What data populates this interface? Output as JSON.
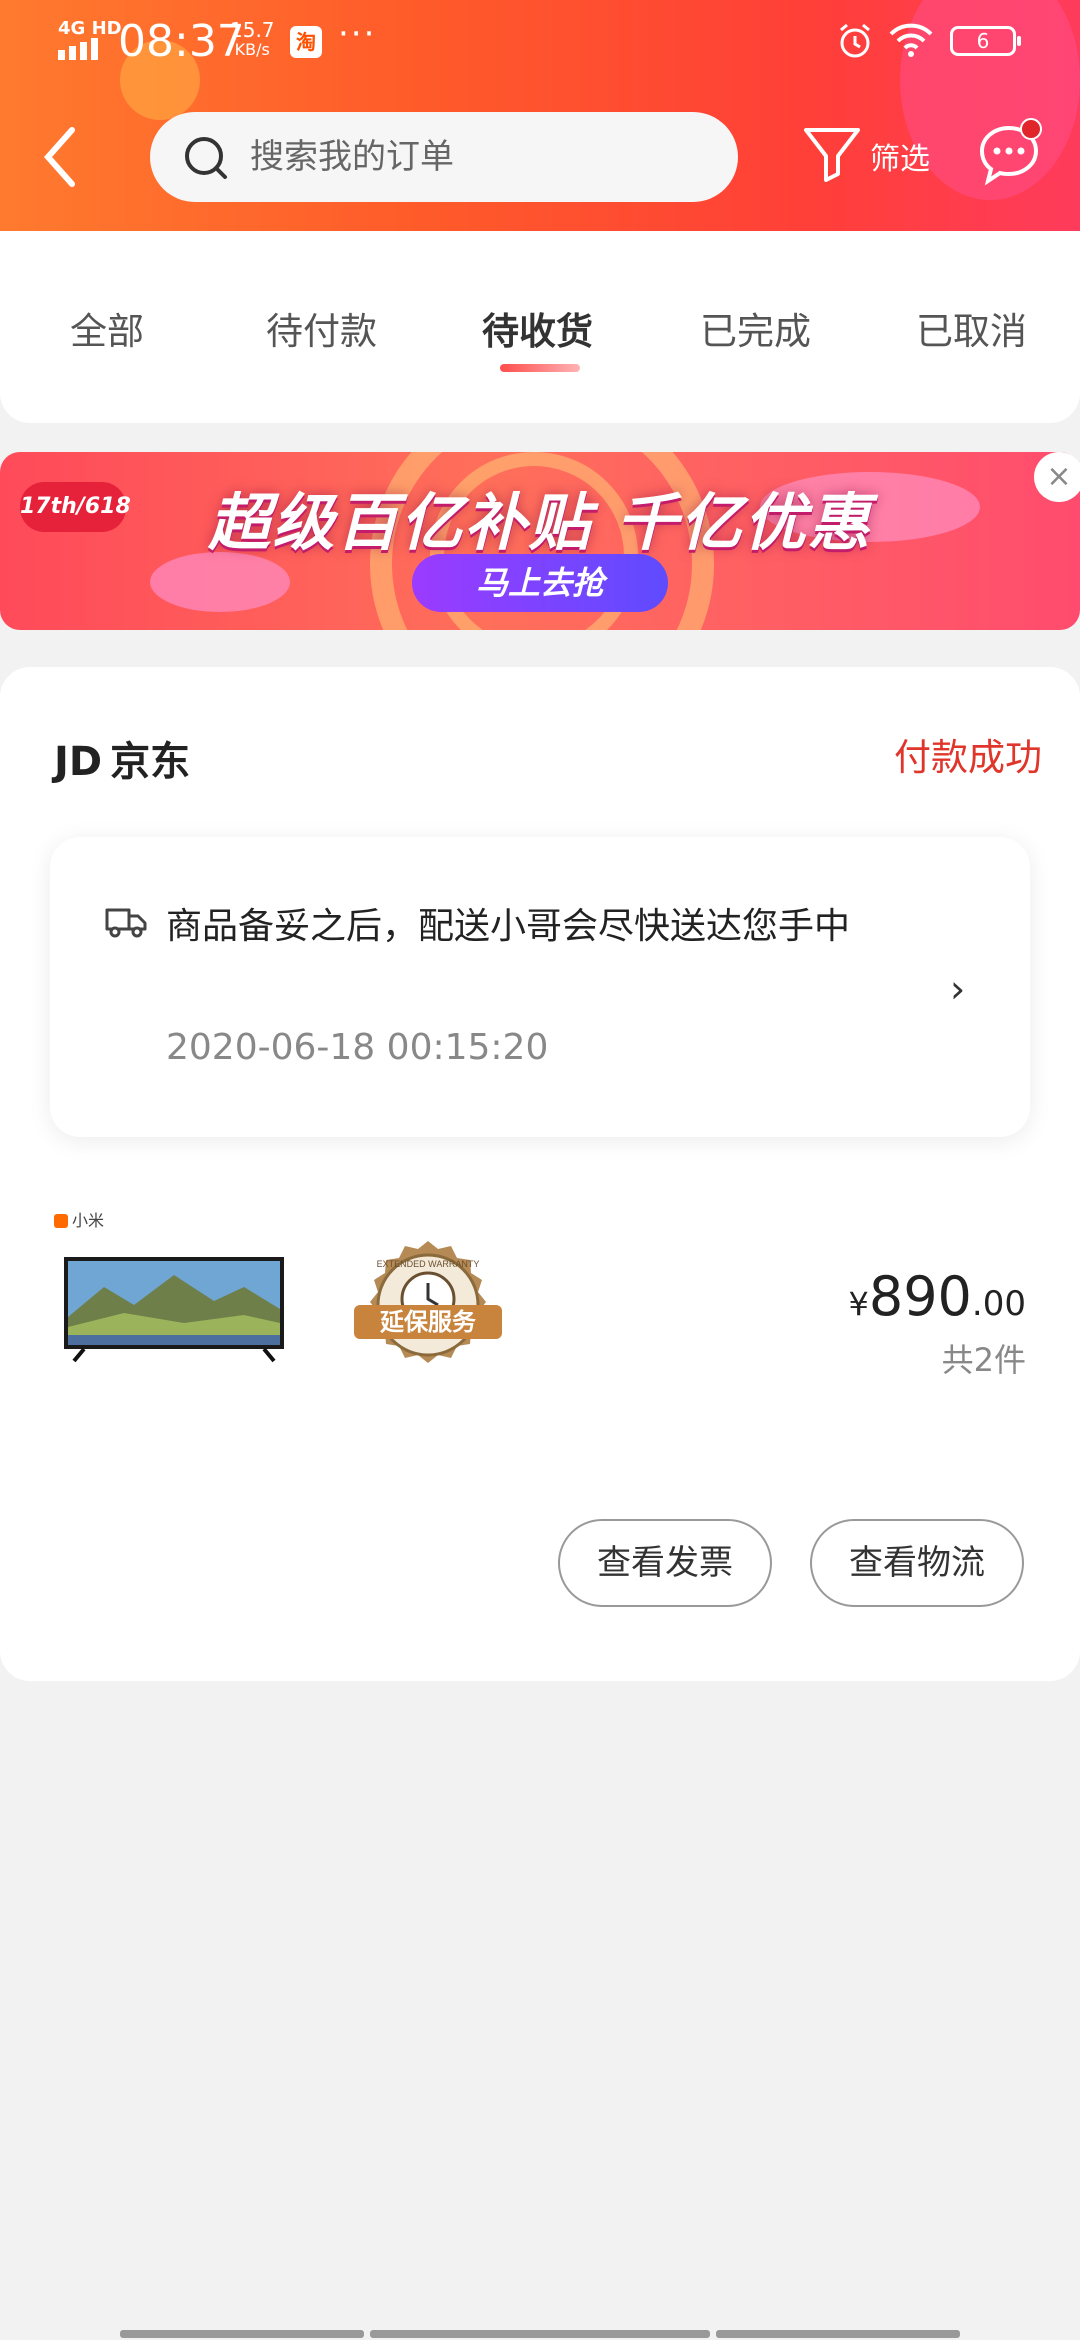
{
  "status_bar": {
    "network": "4G HD",
    "time": "08:37",
    "speed_value": "15.7",
    "speed_unit": "KB/s",
    "app_badge": "淘",
    "more": "···",
    "battery": "6"
  },
  "header": {
    "search_placeholder": "搜索我的订单",
    "filter_label": "筛选"
  },
  "tabs": [
    {
      "label": "全部"
    },
    {
      "label": "待付款"
    },
    {
      "label": "待收货"
    },
    {
      "label": "已完成"
    },
    {
      "label": "已取消"
    }
  ],
  "banner": {
    "tag": "17th/618",
    "title": "超级百亿补贴 千亿优惠",
    "button": "马上去抢",
    "close": "×"
  },
  "order": {
    "shop_logo": "JD",
    "shop_name": "京东",
    "status": "付款成功",
    "shipping_text": "商品备妥之后，配送小哥会尽快送达您手中",
    "shipping_time": "2020-06-18 00:15:20",
    "chevron": "›",
    "brand": "小米",
    "warranty_label": "延保服务",
    "warranty_ring": "EXTENDED WARRANTY",
    "price_currency": "¥",
    "price_int": "890",
    "price_dec": ".00",
    "item_count": "共2件",
    "buttons": [
      "查看发票",
      "查看物流"
    ]
  },
  "colors": {
    "accent": "#e0352b",
    "header_from": "#ff7a2e",
    "header_to": "#ff3b5c"
  }
}
